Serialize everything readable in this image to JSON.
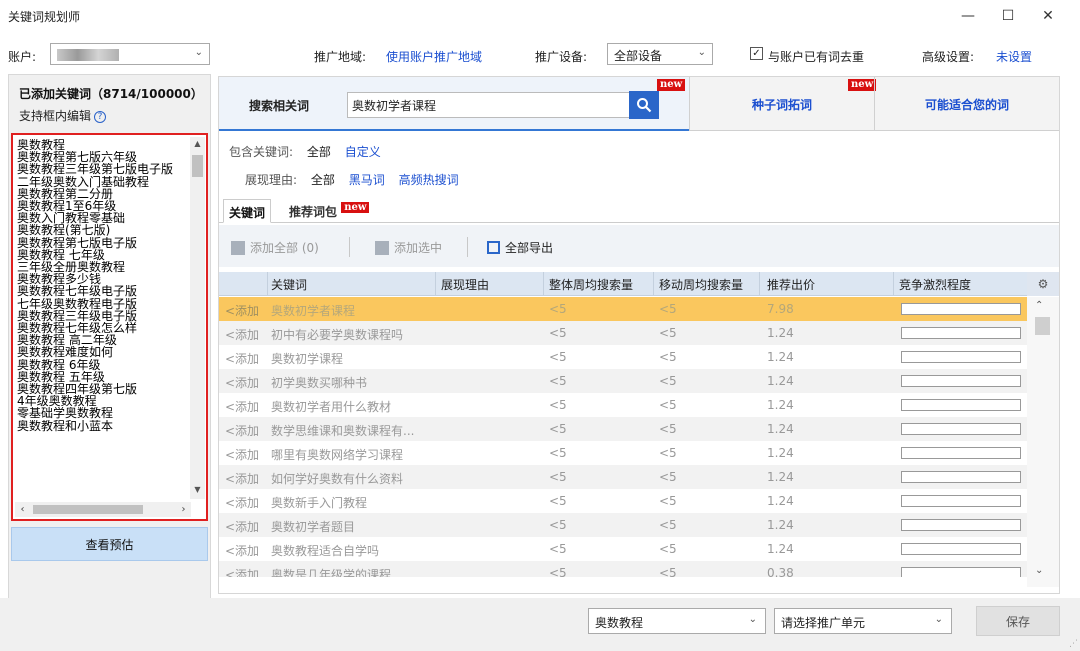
{
  "window": {
    "title": "关键词规划师",
    "min_glyph": "—",
    "max_glyph": "☐",
    "close_glyph": "✕"
  },
  "top": {
    "account_label": "账户:",
    "region_label": "推广地域:",
    "region_value": "使用账户推广地域",
    "device_label": "推广设备:",
    "device_value": "全部设备",
    "dedupe_label": "与账户已有词去重",
    "dedupe_checked": true,
    "advanced_label": "高级设置:",
    "advanced_value": "未设置"
  },
  "left": {
    "added_header": "已添加关键词（8714/100000）",
    "edit_hint": "支持框内编辑",
    "keywords": [
      "奥数教程",
      "奥数教程第七版六年级",
      "奥数教程三年级第七版电子版",
      "二年级奥数入门基础教程",
      "奥数教程第二分册",
      "奥数教程1至6年级",
      "奥数入门教程零基础",
      "奥数教程(第七版)",
      "奥数教程第七版电子版",
      "奥数教程 七年级",
      "三年级全册奥数教程",
      "奥数教程多少钱",
      "奥数教程七年级电子版",
      "七年级奥数教程电子版",
      "奥数教程三年级电子版",
      "奥数教程七年级怎么样",
      "奥数教程 高二年级",
      "奥数教程难度如何",
      "奥数教程 6年级",
      "奥数教程 五年级",
      "奥数教程四年级第七版",
      "4年级奥数教程",
      "零基础学奥数教程",
      "奥数教程和小蓝本"
    ],
    "preview_button": "查看预估"
  },
  "tabs": {
    "search_label": "搜索相关词",
    "search_value": "奥数初学者课程",
    "seed_label": "种子词拓词",
    "suggest_label": "可能适合您的词",
    "new_badge": "new"
  },
  "filters": {
    "include_label": "包含关键词:",
    "include_all": "全部",
    "include_custom": "自定义",
    "reason_label": "展现理由:",
    "reason_all": "全部",
    "reason_dark": "黑马词",
    "reason_hot": "高频热搜词"
  },
  "subtabs": {
    "keywords": "关键词",
    "packages": "推荐词包"
  },
  "toolbar": {
    "add_all": "添加全部 (0)",
    "add_selected": "添加选中",
    "export_all": "全部导出"
  },
  "table": {
    "headers": [
      "关键词",
      "展现理由",
      "整体周均搜索量",
      "移动周均搜索量",
      "推荐出价",
      "竞争激烈程度"
    ],
    "add_label": "<添加",
    "rows": [
      {
        "kw": "奥数初学者课程",
        "reason": "",
        "total": "<5",
        "mobile": "<5",
        "bid": "7.98",
        "competition": 0
      },
      {
        "kw": "初中有必要学奥数课程吗",
        "reason": "",
        "total": "<5",
        "mobile": "<5",
        "bid": "1.24",
        "competition": 0
      },
      {
        "kw": "奥数初学课程",
        "reason": "",
        "total": "<5",
        "mobile": "<5",
        "bid": "1.24",
        "competition": 0
      },
      {
        "kw": "初学奥数买哪种书",
        "reason": "",
        "total": "<5",
        "mobile": "<5",
        "bid": "1.24",
        "competition": 0
      },
      {
        "kw": "奥数初学者用什么教材",
        "reason": "",
        "total": "<5",
        "mobile": "<5",
        "bid": "1.24",
        "competition": 0
      },
      {
        "kw": "数学思维课和奥数课程有...",
        "reason": "",
        "total": "<5",
        "mobile": "<5",
        "bid": "1.24",
        "competition": 0
      },
      {
        "kw": "哪里有奥数网络学习课程",
        "reason": "",
        "total": "<5",
        "mobile": "<5",
        "bid": "1.24",
        "competition": 0
      },
      {
        "kw": "如何学好奥数有什么资料",
        "reason": "",
        "total": "<5",
        "mobile": "<5",
        "bid": "1.24",
        "competition": 0
      },
      {
        "kw": "奥数新手入门教程",
        "reason": "",
        "total": "<5",
        "mobile": "<5",
        "bid": "1.24",
        "competition": 0
      },
      {
        "kw": "奥数初学者题目",
        "reason": "",
        "total": "<5",
        "mobile": "<5",
        "bid": "1.24",
        "competition": 0
      },
      {
        "kw": "奥数教程适合自学吗",
        "reason": "",
        "total": "<5",
        "mobile": "<5",
        "bid": "1.24",
        "competition": 0
      },
      {
        "kw": "奥数是几年级学的课程",
        "reason": "",
        "total": "<5",
        "mobile": "<5",
        "bid": "0.38",
        "competition": 0
      }
    ]
  },
  "bottom": {
    "plan_select": "奥数教程",
    "unit_select": "请选择推广单元",
    "save_button": "保存"
  },
  "colors": {
    "accent": "#2a66c9",
    "link": "#1b4fd0",
    "highlight_row": "#fac75e",
    "red_border": "#e02020",
    "new_badge": "#d81010"
  }
}
